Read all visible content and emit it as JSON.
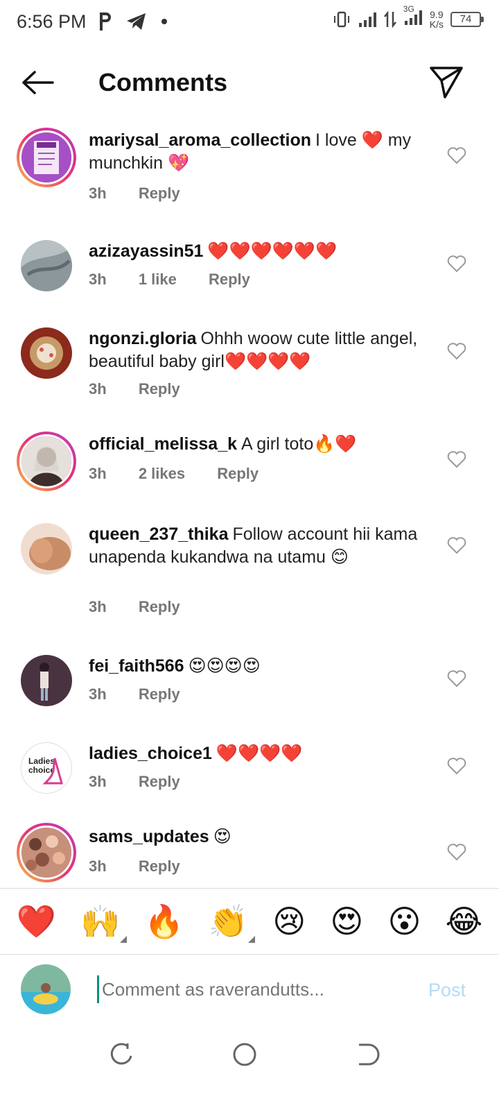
{
  "status_bar": {
    "time": "6:56 PM",
    "speed_value": "9.9",
    "speed_unit": "K/s",
    "network": "3G",
    "battery": "74"
  },
  "header": {
    "title": "Comments"
  },
  "comments": [
    {
      "username": "mariysal_aroma_collection",
      "text": "I love ❤️ my munchkin 💖",
      "time": "3h",
      "likes": "",
      "reply": "Reply"
    },
    {
      "username": "azizayassin51",
      "text": "❤️❤️❤️❤️❤️❤️",
      "time": "3h",
      "likes": "1 like",
      "reply": "Reply"
    },
    {
      "username": "ngonzi.gloria",
      "text": "Ohhh woow cute little angel, beautiful baby girl❤️❤️❤️❤️",
      "time": "3h",
      "likes": "",
      "reply": "Reply"
    },
    {
      "username": "official_melissa_k",
      "text": "A girl toto🔥❤️",
      "time": "3h",
      "likes": "2 likes",
      "reply": "Reply"
    },
    {
      "username": "queen_237_thika",
      "text": "Follow account hii kama unapenda kukandwa na utamu 😊",
      "time": "3h",
      "likes": "",
      "reply": "Reply"
    },
    {
      "username": "fei_faith566",
      "text": "😍😍😍😍",
      "time": "3h",
      "likes": "",
      "reply": "Reply"
    },
    {
      "username": "ladies_choice1",
      "text": "❤️❤️❤️❤️",
      "time": "3h",
      "likes": "",
      "reply": "Reply"
    },
    {
      "username": "sams_updates",
      "text": "😍",
      "time": "3h",
      "likes": "",
      "reply": "Reply"
    }
  ],
  "avatar_logos": {
    "ladies_choice_line1": "Ladies",
    "ladies_choice_line2": "choice"
  },
  "emoji_bar": [
    "❤️",
    "🙌",
    "🔥",
    "👏",
    "😢",
    "😍",
    "😮",
    "😂"
  ],
  "input": {
    "placeholder": "Comment as raverandutts...",
    "post_label": "Post"
  },
  "colors": {
    "ring_start": "#f9c54a",
    "ring_end": "#b83cc2",
    "post_disabled": "#b3dbf5",
    "cursor": "#0a8f7e"
  }
}
